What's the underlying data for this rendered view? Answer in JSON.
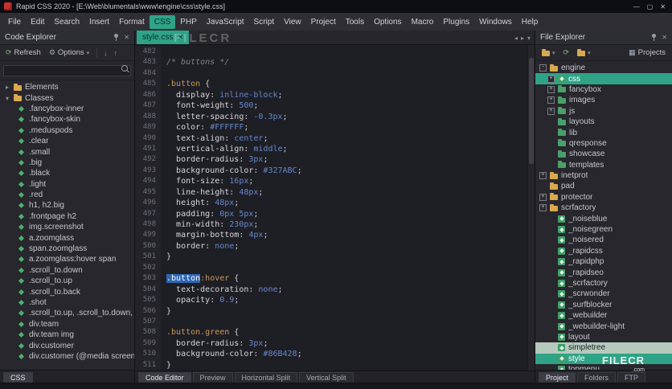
{
  "window": {
    "title": "Rapid CSS 2020 - [E:\\Web\\blumentals\\www\\engine\\css\\style.css]",
    "controls": {
      "minimize": "—",
      "maximize": "▢",
      "close": "✕"
    }
  },
  "menu": {
    "items": [
      "File",
      "Edit",
      "Search",
      "Insert",
      "Format",
      "CSS",
      "PHP",
      "JavaScript",
      "Script",
      "View",
      "Project",
      "Tools",
      "Options",
      "Macro",
      "Plugins",
      "Windows",
      "Help"
    ],
    "active": "CSS"
  },
  "colors": {
    "accent_teal": "#2fa387",
    "selection_blue": "#2e66b3",
    "selector_orange": "#c99a5a",
    "value_blue": "#6688cc",
    "comment_gray": "#80808a",
    "folder_yellow": "#d9a94e",
    "file_green": "#3f9e68"
  },
  "code_explorer": {
    "title": "Code Explorer",
    "toolbar": {
      "refresh_label": "Refresh",
      "options_label": "Options"
    },
    "search": {
      "placeholder": ""
    },
    "folders": [
      {
        "label": "Elements",
        "expanded": false,
        "children": []
      },
      {
        "label": "Classes",
        "expanded": true,
        "children": [
          ".fancybox-inner",
          ".fancybox-skin",
          ".meduspods",
          ".clear",
          ".small",
          ".big",
          ".black",
          ".light",
          ".red",
          "h1, h2.big",
          ".frontpage h2",
          "img.screenshot",
          "a.zoomglass",
          "span.zoomglass",
          "a.zoomglass:hover span",
          ".scroll_to.down",
          ".scroll_to.up",
          ".scroll_to.back",
          ".shot",
          ".scroll_to.up, .scroll_to.down,",
          "div.team",
          "div.team img",
          "div.customer",
          "div.customer (@media screen"
        ]
      }
    ],
    "bottom_tab": "CSS"
  },
  "editor": {
    "tab": {
      "label": "style.css",
      "close": "✕"
    },
    "bottom_tabs": [
      "Code Editor",
      "Preview",
      "Horizontal Split",
      "Vertical Split"
    ],
    "active_bottom_tab": "Code Editor",
    "lines": [
      {
        "num": 482,
        "tokens": []
      },
      {
        "num": 483,
        "tokens": [
          [
            "c",
            "/* buttons */"
          ]
        ]
      },
      {
        "num": 484,
        "tokens": []
      },
      {
        "num": 485,
        "tokens": [
          [
            "s",
            ".button"
          ],
          [
            "p",
            " {"
          ]
        ]
      },
      {
        "num": 486,
        "tokens": [
          [
            "p",
            "  "
          ],
          [
            "n",
            "display"
          ],
          [
            "p",
            ": "
          ],
          [
            "v",
            "inline-block"
          ],
          [
            "p",
            ";"
          ]
        ]
      },
      {
        "num": 487,
        "tokens": [
          [
            "p",
            "  "
          ],
          [
            "n",
            "font-weight"
          ],
          [
            "p",
            ": "
          ],
          [
            "v",
            "500"
          ],
          [
            "p",
            ";"
          ]
        ]
      },
      {
        "num": 488,
        "tokens": [
          [
            "p",
            "  "
          ],
          [
            "n",
            "letter-spacing"
          ],
          [
            "p",
            ": "
          ],
          [
            "v",
            "-0.3px"
          ],
          [
            "p",
            ";"
          ]
        ]
      },
      {
        "num": 489,
        "tokens": [
          [
            "p",
            "  "
          ],
          [
            "n",
            "color"
          ],
          [
            "p",
            ": "
          ],
          [
            "v",
            "#FFFFFF"
          ],
          [
            "p",
            ";"
          ]
        ]
      },
      {
        "num": 490,
        "tokens": [
          [
            "p",
            "  "
          ],
          [
            "n",
            "text-align"
          ],
          [
            "p",
            ": "
          ],
          [
            "v",
            "center"
          ],
          [
            "p",
            ";"
          ]
        ]
      },
      {
        "num": 491,
        "tokens": [
          [
            "p",
            "  "
          ],
          [
            "n",
            "vertical-align"
          ],
          [
            "p",
            ": "
          ],
          [
            "v",
            "middle"
          ],
          [
            "p",
            ";"
          ]
        ]
      },
      {
        "num": 492,
        "tokens": [
          [
            "p",
            "  "
          ],
          [
            "n",
            "border-radius"
          ],
          [
            "p",
            ": "
          ],
          [
            "v",
            "3px"
          ],
          [
            "p",
            ";"
          ]
        ]
      },
      {
        "num": 493,
        "tokens": [
          [
            "p",
            "  "
          ],
          [
            "n",
            "background-color"
          ],
          [
            "p",
            ": "
          ],
          [
            "v",
            "#327ABC"
          ],
          [
            "p",
            ";"
          ]
        ]
      },
      {
        "num": 494,
        "tokens": [
          [
            "p",
            "  "
          ],
          [
            "n",
            "font-size"
          ],
          [
            "p",
            ": "
          ],
          [
            "v",
            "16px"
          ],
          [
            "p",
            ";"
          ]
        ]
      },
      {
        "num": 495,
        "tokens": [
          [
            "p",
            "  "
          ],
          [
            "n",
            "line-height"
          ],
          [
            "p",
            ": "
          ],
          [
            "v",
            "48px"
          ],
          [
            "p",
            ";"
          ]
        ]
      },
      {
        "num": 496,
        "tokens": [
          [
            "p",
            "  "
          ],
          [
            "n",
            "height"
          ],
          [
            "p",
            ": "
          ],
          [
            "v",
            "48px"
          ],
          [
            "p",
            ";"
          ]
        ]
      },
      {
        "num": 497,
        "tokens": [
          [
            "p",
            "  "
          ],
          [
            "n",
            "padding"
          ],
          [
            "p",
            ": "
          ],
          [
            "v",
            "0px 5px"
          ],
          [
            "p",
            ";"
          ]
        ]
      },
      {
        "num": 498,
        "tokens": [
          [
            "p",
            "  "
          ],
          [
            "n",
            "min-width"
          ],
          [
            "p",
            ": "
          ],
          [
            "v",
            "230px"
          ],
          [
            "p",
            ";"
          ]
        ]
      },
      {
        "num": 499,
        "tokens": [
          [
            "p",
            "  "
          ],
          [
            "n",
            "margin-bottom"
          ],
          [
            "p",
            ": "
          ],
          [
            "v",
            "4px"
          ],
          [
            "p",
            ";"
          ]
        ]
      },
      {
        "num": 500,
        "tokens": [
          [
            "p",
            "  "
          ],
          [
            "n",
            "border"
          ],
          [
            "p",
            ": "
          ],
          [
            "v",
            "none"
          ],
          [
            "p",
            ";"
          ]
        ]
      },
      {
        "num": 501,
        "tokens": [
          [
            "p",
            "}"
          ]
        ]
      },
      {
        "num": 502,
        "tokens": []
      },
      {
        "num": 503,
        "tokens": [
          [
            "h",
            ".button"
          ],
          [
            "s",
            ":hover"
          ],
          [
            "p",
            " {"
          ]
        ]
      },
      {
        "num": 504,
        "tokens": [
          [
            "p",
            "  "
          ],
          [
            "n",
            "text-decoration"
          ],
          [
            "p",
            ": "
          ],
          [
            "v",
            "none"
          ],
          [
            "p",
            ";"
          ]
        ]
      },
      {
        "num": 505,
        "tokens": [
          [
            "p",
            "  "
          ],
          [
            "n",
            "opacity"
          ],
          [
            "p",
            ": "
          ],
          [
            "v",
            "0.9"
          ],
          [
            "p",
            ";"
          ]
        ]
      },
      {
        "num": 506,
        "tokens": [
          [
            "p",
            "}"
          ]
        ]
      },
      {
        "num": 507,
        "tokens": []
      },
      {
        "num": 508,
        "tokens": [
          [
            "s",
            ".button.green"
          ],
          [
            "p",
            " {"
          ]
        ]
      },
      {
        "num": 509,
        "tokens": [
          [
            "p",
            "  "
          ],
          [
            "n",
            "border-radius"
          ],
          [
            "p",
            ": "
          ],
          [
            "v",
            "3px"
          ],
          [
            "p",
            ";"
          ]
        ]
      },
      {
        "num": 510,
        "tokens": [
          [
            "p",
            "  "
          ],
          [
            "n",
            "background-color"
          ],
          [
            "p",
            ": "
          ],
          [
            "v",
            "#86B428"
          ],
          [
            "p",
            ";"
          ]
        ]
      },
      {
        "num": 511,
        "tokens": [
          [
            "p",
            "}"
          ]
        ]
      }
    ]
  },
  "file_explorer": {
    "title": "File Explorer",
    "toolbar": {
      "projects_label": "Projects"
    },
    "tree": [
      {
        "label": "engine",
        "depth": 0,
        "icon": "folder",
        "exp": "-"
      },
      {
        "label": "css",
        "depth": 1,
        "icon": "cssfile",
        "exp": "+",
        "state": "selected"
      },
      {
        "label": "fancybox",
        "depth": 1,
        "icon": "folder-green",
        "exp": "+"
      },
      {
        "label": "images",
        "depth": 1,
        "icon": "folder-green",
        "exp": "+"
      },
      {
        "label": "js",
        "depth": 1,
        "icon": "folder-green",
        "exp": "+"
      },
      {
        "label": "layouts",
        "depth": 1,
        "icon": "folder-green",
        "exp": ""
      },
      {
        "label": "lib",
        "depth": 1,
        "icon": "folder-green",
        "exp": ""
      },
      {
        "label": "qresponse",
        "depth": 1,
        "icon": "folder-green",
        "exp": ""
      },
      {
        "label": "showcase",
        "depth": 1,
        "icon": "folder-green",
        "exp": ""
      },
      {
        "label": "templates",
        "depth": 1,
        "icon": "folder-green",
        "exp": ""
      },
      {
        "label": "inetprot",
        "depth": 0,
        "icon": "folder",
        "exp": "+"
      },
      {
        "label": "pad",
        "depth": 0,
        "icon": "folder",
        "exp": ""
      },
      {
        "label": "protector",
        "depth": 0,
        "icon": "folder",
        "exp": "+"
      },
      {
        "label": "scrfactory",
        "depth": 0,
        "icon": "folder",
        "exp": "+"
      },
      {
        "label": "_noiseblue",
        "depth": 1,
        "icon": "cssfile",
        "exp": ""
      },
      {
        "label": "_noisegreen",
        "depth": 1,
        "icon": "cssfile",
        "exp": ""
      },
      {
        "label": "_noisered",
        "depth": 1,
        "icon": "cssfile",
        "exp": ""
      },
      {
        "label": "_rapidcss",
        "depth": 1,
        "icon": "cssfile",
        "exp": ""
      },
      {
        "label": "_rapidphp",
        "depth": 1,
        "icon": "cssfile",
        "exp": ""
      },
      {
        "label": "_rapidseo",
        "depth": 1,
        "icon": "cssfile",
        "exp": ""
      },
      {
        "label": "_scrfactory",
        "depth": 1,
        "icon": "cssfile",
        "exp": ""
      },
      {
        "label": "_scrwonder",
        "depth": 1,
        "icon": "cssfile",
        "exp": ""
      },
      {
        "label": "_surfblocker",
        "depth": 1,
        "icon": "cssfile",
        "exp": ""
      },
      {
        "label": "_webuilder",
        "depth": 1,
        "icon": "cssfile",
        "exp": ""
      },
      {
        "label": "_webuilder-light",
        "depth": 1,
        "icon": "cssfile",
        "exp": ""
      },
      {
        "label": "layout",
        "depth": 1,
        "icon": "cssfile",
        "exp": ""
      },
      {
        "label": "simpletree",
        "depth": 1,
        "icon": "cssfile",
        "exp": "",
        "state": "hover"
      },
      {
        "label": "style",
        "depth": 1,
        "icon": "cssfile",
        "exp": "",
        "state": "selected"
      },
      {
        "label": "topmenu",
        "depth": 1,
        "icon": "cssfile",
        "exp": ""
      }
    ],
    "bottom_tabs": [
      "Project",
      "Folders",
      "FTP"
    ],
    "active_bottom_tab": "Project"
  },
  "watermark": {
    "center": "FILECR",
    "corner": "FILECR",
    "corner_suffix": ".com"
  }
}
